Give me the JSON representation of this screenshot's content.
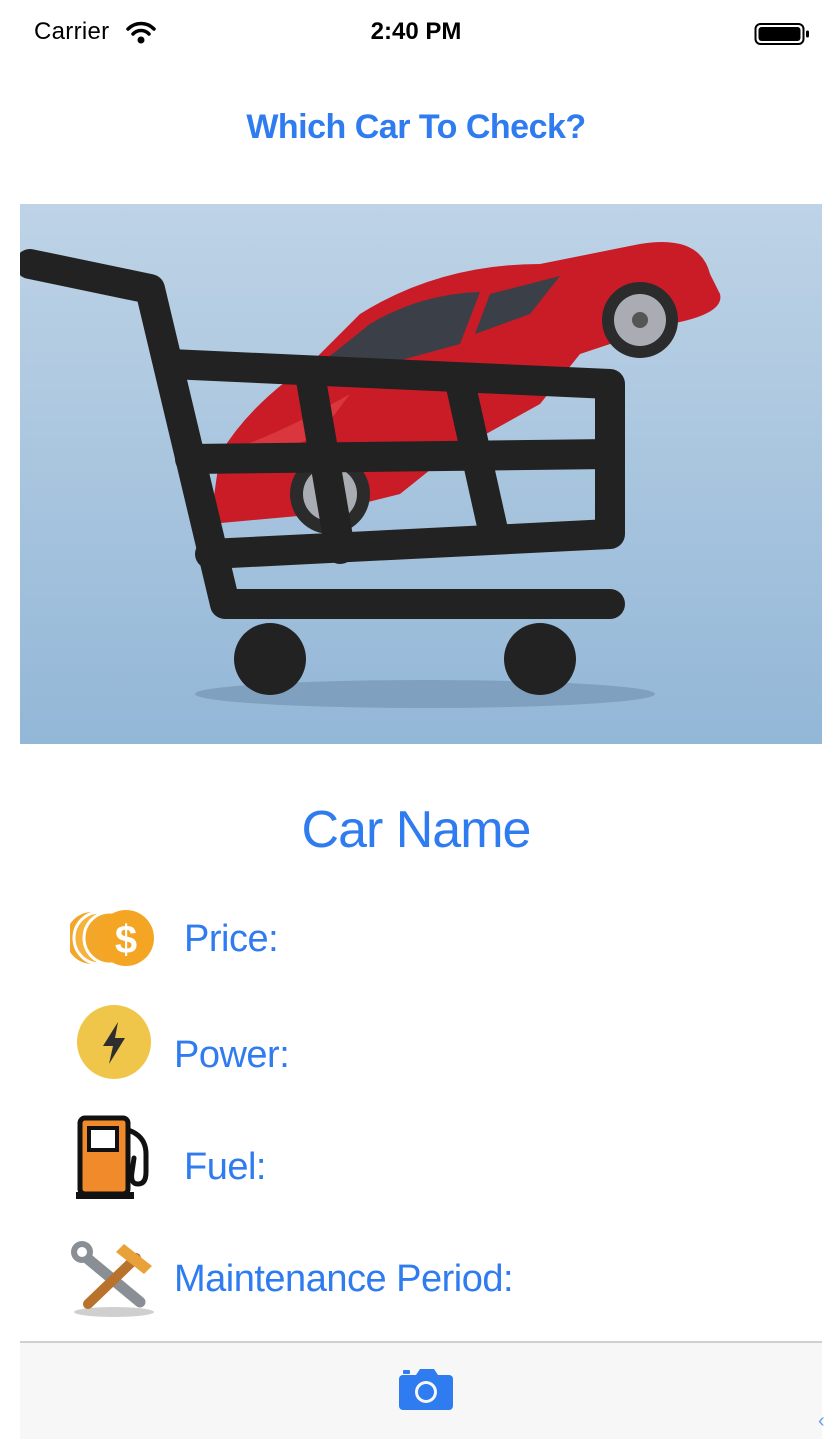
{
  "status_bar": {
    "carrier": "Carrier",
    "time": "2:40 PM",
    "icons": [
      "wifi-icon",
      "battery-icon"
    ]
  },
  "header": {
    "title": "Which Car To Check?"
  },
  "hero": {
    "image": "shopping-cart-with-red-car",
    "colors": {
      "background_top": "#bed3e6",
      "background_bottom": "#93b7d7",
      "car": "#c91c26",
      "cart": "#222222"
    }
  },
  "car": {
    "name": "Car Name"
  },
  "specs": [
    {
      "icon": "coins-dollar-icon",
      "label": "Price:"
    },
    {
      "icon": "lightning-bolt-icon",
      "label": "Power:"
    },
    {
      "icon": "fuel-pump-icon",
      "label": "Fuel:"
    },
    {
      "icon": "wrench-hammer-icon",
      "label": "Maintenance Period:"
    }
  ],
  "toolbar": {
    "camera_icon": "camera-icon"
  },
  "colors": {
    "accent": "#2f7bf0",
    "toolbar_background": "#f7f7f7"
  }
}
